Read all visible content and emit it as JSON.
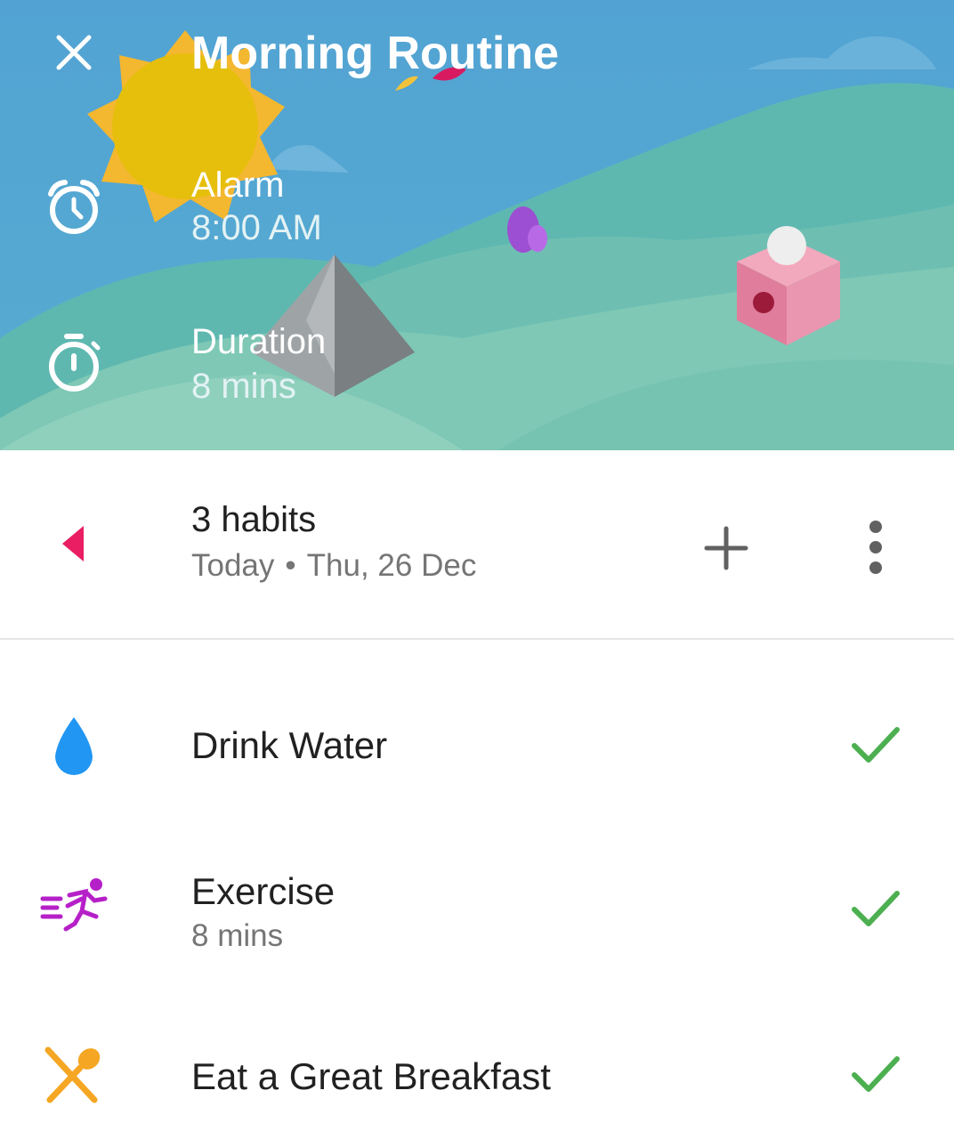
{
  "header": {
    "title": "Morning Routine",
    "background_color": "#4fa3d1",
    "close_icon": "close-icon",
    "alarm": {
      "icon": "alarm-clock-icon",
      "label": "Alarm",
      "value": "8:00 AM"
    },
    "duration": {
      "icon": "stopwatch-icon",
      "label": "Duration",
      "value": "8 mins"
    }
  },
  "summary": {
    "habit_count": "3 habits",
    "day": "Today",
    "separator": "•",
    "date": "Thu, 26 Dec",
    "back_icon": "arrow-left-icon",
    "add_icon": "plus-icon",
    "more_icon": "more-vertical-icon",
    "accent_color": "#e91e63"
  },
  "habits": [
    {
      "name": "Drink Water",
      "icon": "water-drop-icon",
      "icon_color": "#2196f3",
      "completed": true
    },
    {
      "name": "Exercise",
      "subtitle": "8 mins",
      "icon": "running-icon",
      "icon_color": "#b620c8",
      "completed": true
    },
    {
      "name": "Eat a Great Breakfast",
      "icon": "utensils-icon",
      "icon_color": "#f5a623",
      "completed": true
    }
  ],
  "check_color": "#4caf50"
}
